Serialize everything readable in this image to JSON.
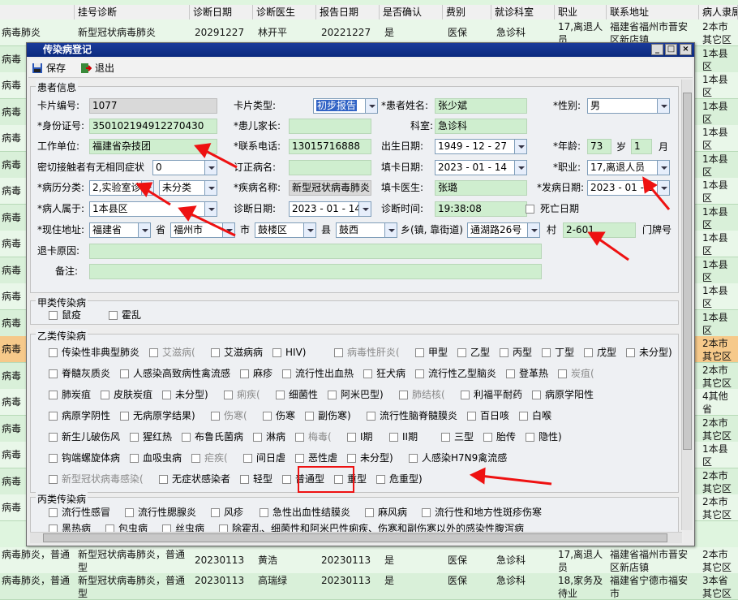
{
  "grid": {
    "headers": [
      "挂号诊断",
      "诊断日期",
      "诊断医生",
      "报告日期",
      "是否确认",
      "费别",
      "就诊科室",
      "职业",
      "联系地址",
      "病人隶属"
    ],
    "left_col_texts": [
      "病毒肺炎",
      "病毒肺",
      "病毒肺",
      "病毒肺",
      "病毒肺",
      "病毒肺",
      "病毒肺",
      "病毒肺",
      "病毒肺",
      "病毒肺",
      "病毒肺",
      "病毒肺",
      "病毒肺",
      "病毒肺",
      "病毒肺",
      "病毒肺",
      "病毒肺",
      "病毒肺",
      "病毒肺",
      "病毒肺"
    ],
    "right_col_texts": [
      "2本市其它区",
      "1本县区",
      "1本县区",
      "1本县区",
      "1本县区",
      "1本县区",
      "1本县区",
      "1本县区",
      "1本县区",
      "1本县区",
      "1本县区",
      "1本县区",
      "2本市其它区",
      "2本市其它区",
      "4其他省",
      "2本市其它区",
      "1本县区",
      "2本市其它区",
      "2本市其它区",
      "3本省其它区"
    ],
    "first_row": {
      "diag": "新型冠状病毒肺炎",
      "date": "20291227",
      "doctor": "林开平",
      "report": "20221227",
      "confirm": "是",
      "fee": "医保",
      "dept": "急诊科",
      "job": "17,离退人员",
      "addr": "福建省福州市晋安区新店镇",
      "belong": "2本市其它区"
    },
    "bottom_rows": [
      {
        "left": "病毒肺炎，普通",
        "diag": "新型冠状病毒肺炎，普通型",
        "date": "20230113",
        "doctor": "黄浩",
        "report": "20230113",
        "confirm": "是",
        "fee": "医保",
        "dept": "急诊科",
        "job": "17,离退人员",
        "addr": "福建省福州市晋安区新店镇",
        "belong": "2本市其它区"
      },
      {
        "left": "病毒肺炎，普通",
        "diag": "新型冠状病毒肺炎，普通型",
        "date": "20230113",
        "doctor": "高瑞绿",
        "report": "20230113",
        "confirm": "是",
        "fee": "医保",
        "dept": "急诊科",
        "job": "18,家务及待业",
        "addr": "福建省宁德市福安市",
        "belong": "3本省其它区"
      }
    ]
  },
  "window": {
    "title": "传染病登记",
    "save_label": "保存",
    "exit_label": "退出",
    "accent": "#0b2a7e"
  },
  "patient": {
    "section_title": "患者信息",
    "card_no_label": "卡片编号:",
    "card_no": "1077",
    "card_type_label": "卡片类型:",
    "card_type": "初步报告",
    "patient_name_label": "患者姓名:",
    "patient_name": "张少斌",
    "sex_label": "性别:",
    "sex": "男",
    "id_label": "身份证号:",
    "id_no": "350102194912270430",
    "guardian_label": "患儿家长:",
    "guardian": "",
    "dept_label": "科室:",
    "dept": "急诊科",
    "work_label": "工作单位:",
    "work": "福建省杂技团",
    "phone_label": "联系电话:",
    "phone": "13015716888",
    "birth_label": "出生日期:",
    "birth": "1949 - 12 - 27",
    "age_label": "年龄:",
    "age_years": "73",
    "age_year_unit": "岁",
    "age_months": "1",
    "age_month_unit": "月",
    "contact_label": "密切接触者有无相同症状",
    "contact": "0",
    "revised_label": "订正病名:",
    "revised": "",
    "fill_date_label": "填卡日期:",
    "fill_date": "2023 - 01 - 14",
    "job_label": "职业:",
    "job": "17,离退人员",
    "case_class_label": "病历分类:",
    "case_class": "2,实验室诊",
    "case_class2": "未分类",
    "disease_label": "疾病名称:",
    "disease": "新型冠状病毒肺炎",
    "fill_doctor_label": "填卡医生:",
    "fill_doctor": "张璐",
    "onset_label": "发病日期:",
    "onset": "2023 - 01 - 1",
    "belong_label": "病人属于:",
    "belong": "1本县区",
    "diag_date_label": "诊断日期:",
    "diag_date": "2023 - 01 - 14",
    "diag_time_label": "诊断时间:",
    "diag_time": "19:38:08",
    "death_label": "死亡日期",
    "addr_label": "现住地址:",
    "province": "福建省",
    "province_unit": "省",
    "city": "福州市",
    "city_unit": "市",
    "district": "鼓楼区",
    "district_unit": "县",
    "town": "鼓西",
    "town_unit": "乡(镇, 靠街道)",
    "village": "通湖路26号",
    "village_unit": "村",
    "house": "2-601",
    "house_unit": "门牌号",
    "return_label": "退卡原因:",
    "return_reason": "",
    "note_label": "备注:",
    "note": ""
  },
  "class_a": {
    "title": "甲类传染病",
    "items": [
      "鼠疫",
      "霍乱"
    ]
  },
  "class_b": {
    "title": "乙类传染病",
    "rows": [
      [
        "传染性非典型肺炎",
        "艾滋病(",
        "艾滋病病",
        "HIV)",
        "病毒性肝炎(",
        "甲型",
        "乙型",
        "丙型",
        "丁型",
        "戊型",
        "未分型)"
      ],
      [
        "脊髓灰质炎",
        "人感染高致病性禽流感",
        "麻疹",
        "流行性出血热",
        "狂犬病",
        "流行性乙型脑炎",
        "登革热",
        "炭疽("
      ],
      [
        "肺炭疽",
        "皮肤炭疽",
        "未分型)",
        "痢疾(",
        "细菌性",
        "阿米巴型)",
        "肺结核(",
        "利福平耐药",
        "病原学阳性"
      ],
      [
        "病原学阴性",
        "无病原学结果)",
        "伤寒(",
        "伤寒",
        "副伤寒)",
        "流行性脑脊髓膜炎",
        "百日咳",
        "白喉"
      ],
      [
        "新生儿破伤风",
        "猩红热",
        "布鲁氏菌病",
        "淋病",
        "梅毒(",
        "I期",
        "II期",
        "三型",
        "胎传",
        "隐性)"
      ],
      [
        "钩端螺旋体病",
        "血吸虫病",
        "疟疾(",
        "间日虐",
        "恶性虐",
        "未分型)",
        "人感染H7N9禽流感"
      ],
      [
        "新型冠状病毒感染(",
        "无症状感染者",
        "轻型",
        "普通型",
        "重型",
        "危重型)"
      ]
    ]
  },
  "class_c": {
    "title": "丙类传染病",
    "rows": [
      [
        "流行性感冒",
        "流行性腮腺炎",
        "风疹",
        "急性出血性结膜炎",
        "麻风病",
        "流行性和地方性斑疹伤寒"
      ],
      [
        "黑热病",
        "包虫病",
        "丝虫病",
        "除霍乱、细菌性和阿米巴性痢疾、伤寒和副伤寒以外的感染性腹泻病"
      ]
    ]
  }
}
